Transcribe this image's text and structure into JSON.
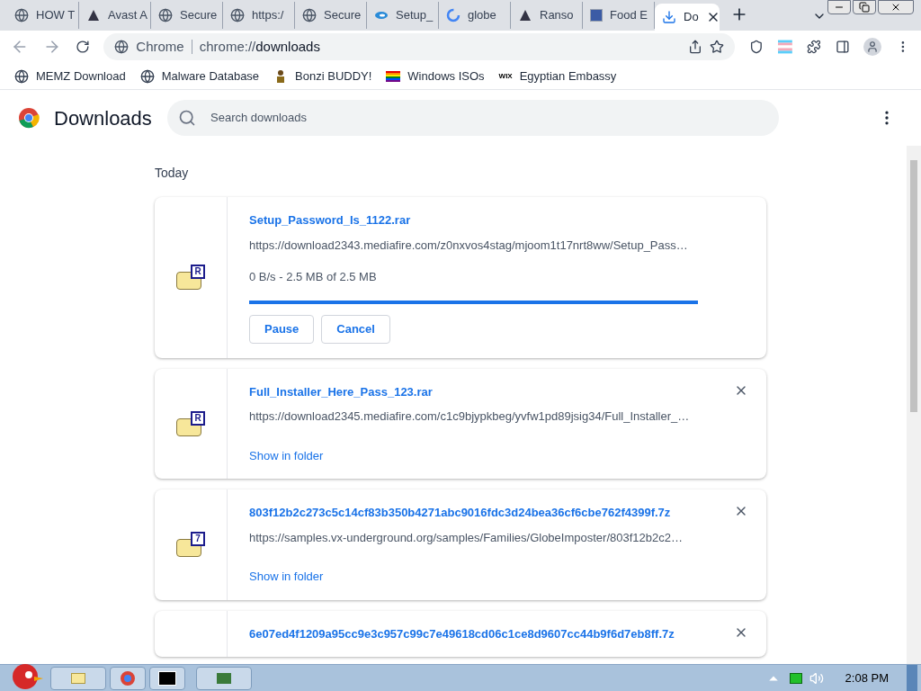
{
  "tabs": [
    {
      "title": "HOW T",
      "selected": false
    },
    {
      "title": "Avast A",
      "selected": false
    },
    {
      "title": "Secure",
      "selected": false
    },
    {
      "title": "https:/",
      "selected": false
    },
    {
      "title": "Secure",
      "selected": false
    },
    {
      "title": "Setup_",
      "selected": false
    },
    {
      "title": "globe",
      "selected": false
    },
    {
      "title": "Ranso",
      "selected": false
    },
    {
      "title": "Food E",
      "selected": false
    },
    {
      "title": "Do",
      "selected": true
    }
  ],
  "address": {
    "site": "Chrome",
    "url_prefix": "chrome://",
    "url_path": "downloads"
  },
  "bookmarks": [
    {
      "label": "MEMZ Download"
    },
    {
      "label": "Malware Database"
    },
    {
      "label": "Bonzi BUDDY!"
    },
    {
      "label": "Windows ISOs"
    },
    {
      "label": "Egyptian Embassy",
      "icon_text": "WIX"
    }
  ],
  "page": {
    "title": "Downloads",
    "search_placeholder": "Search downloads",
    "section": "Today"
  },
  "downloads": [
    {
      "kind": "in_progress",
      "name": "Setup_Password_Is_1122.rar",
      "icon_letter": "R",
      "url": "https://download2343.mediafire.com/z0nxvos4stag/mjoom1t17nrt8ww/Setup_Pass…",
      "status": "0 B/s - 2.5 MB of 2.5 MB",
      "level": 1,
      "buttons": [
        "Pause",
        "Cancel"
      ]
    },
    {
      "kind": "done",
      "name": "Full_Installer_Here_Pass_123.rar",
      "icon_letter": "R",
      "url": "https://download2345.mediafire.com/c1c9bjypkbeg/yvfw1pd89jsig34/Full_Installer_…",
      "link": "Show in folder"
    },
    {
      "kind": "done",
      "name": "803f12b2c273c5c14cf83b350b4271abc9016fdc3d24bea36cf6cbe762f4399f.7z",
      "icon_letter": "7",
      "url": "https://samples.vx-underground.org/samples/Families/GlobeImposter/803f12b2c2…",
      "link": "Show in folder"
    },
    {
      "kind": "cut",
      "name": "6e07ed4f1209a95cc9e3c957c99c7e49618cd06c1ce8d9607cc44b9f6d7eb8ff.7z"
    }
  ],
  "taskbar": {
    "clock": "2:08 PM"
  }
}
